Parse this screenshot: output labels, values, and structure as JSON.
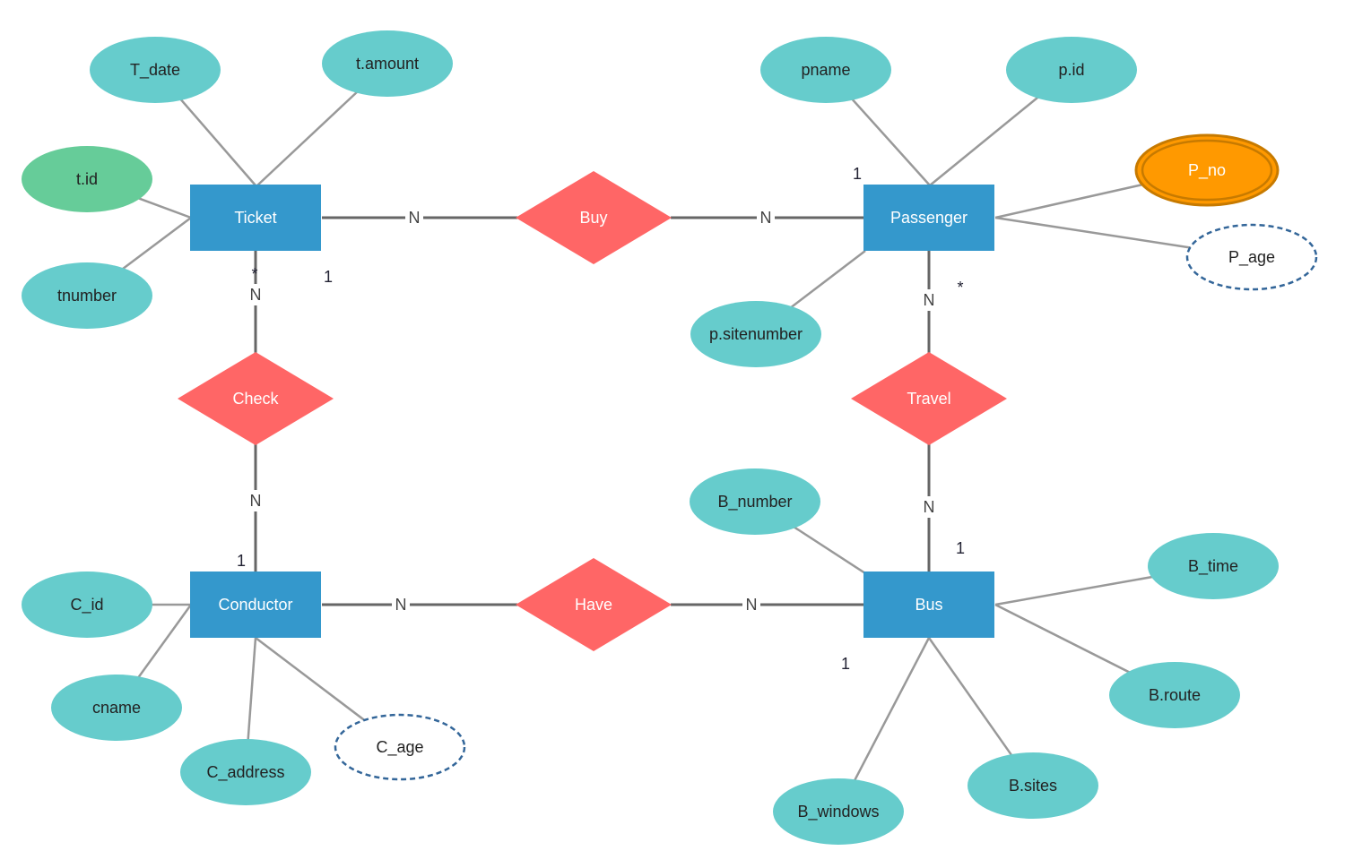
{
  "colors": {
    "entity": "#3498cc",
    "relationship": "#ff6666",
    "attribute": "#66cccc",
    "key_attribute": "#66cc99",
    "multivalued_fill": "#ff9900",
    "multivalued_stroke": "#c77a00",
    "derived_stroke": "#336699",
    "attr_line": "#999999",
    "rel_line": "#666666"
  },
  "entities": [
    {
      "id": "ticket",
      "label": "Ticket"
    },
    {
      "id": "passenger",
      "label": "Passenger"
    },
    {
      "id": "conductor",
      "label": "Conductor"
    },
    {
      "id": "bus",
      "label": "Bus"
    }
  ],
  "relationships": [
    {
      "id": "buy",
      "label": "Buy"
    },
    {
      "id": "check",
      "label": "Check"
    },
    {
      "id": "travel",
      "label": "Travel"
    },
    {
      "id": "have",
      "label": "Have"
    }
  ],
  "attributes": [
    {
      "id": "t_date",
      "label": "T_date",
      "entity": "ticket",
      "kind": "normal"
    },
    {
      "id": "t_amount",
      "label": "t.amount",
      "entity": "ticket",
      "kind": "normal"
    },
    {
      "id": "t_id",
      "label": "t.id",
      "entity": "ticket",
      "kind": "key"
    },
    {
      "id": "tnumber",
      "label": "tnumber",
      "entity": "ticket",
      "kind": "normal"
    },
    {
      "id": "pname",
      "label": "pname",
      "entity": "passenger",
      "kind": "normal"
    },
    {
      "id": "p_id",
      "label": "p.id",
      "entity": "passenger",
      "kind": "normal"
    },
    {
      "id": "p_no",
      "label": "P_no",
      "entity": "passenger",
      "kind": "multivalued"
    },
    {
      "id": "p_age",
      "label": "P_age",
      "entity": "passenger",
      "kind": "derived"
    },
    {
      "id": "p_sitenumber",
      "label": "p.sitenumber",
      "entity": "passenger",
      "kind": "normal"
    },
    {
      "id": "b_number",
      "label": "B_number",
      "entity": "bus",
      "kind": "normal"
    },
    {
      "id": "b_time",
      "label": "B_time",
      "entity": "bus",
      "kind": "normal"
    },
    {
      "id": "b_route",
      "label": "B.route",
      "entity": "bus",
      "kind": "normal"
    },
    {
      "id": "b_sites",
      "label": "B.sites",
      "entity": "bus",
      "kind": "normal"
    },
    {
      "id": "b_windows",
      "label": "B_windows",
      "entity": "bus",
      "kind": "normal"
    },
    {
      "id": "c_id",
      "label": "C_id",
      "entity": "conductor",
      "kind": "normal"
    },
    {
      "id": "cname",
      "label": "cname",
      "entity": "conductor",
      "kind": "normal"
    },
    {
      "id": "c_address",
      "label": "C_address",
      "entity": "conductor",
      "kind": "normal"
    },
    {
      "id": "c_age",
      "label": "C_age",
      "entity": "conductor",
      "kind": "derived"
    }
  ],
  "links": [
    {
      "id": "ticket_buy",
      "from": "ticket",
      "to": "buy",
      "label": "N"
    },
    {
      "id": "buy_passenger",
      "from": "buy",
      "to": "passenger",
      "label": "N"
    },
    {
      "id": "ticket_check",
      "from": "ticket",
      "to": "check",
      "label": "N"
    },
    {
      "id": "check_conductor",
      "from": "check",
      "to": "conductor",
      "label": "N"
    },
    {
      "id": "passenger_travel",
      "from": "passenger",
      "to": "travel",
      "label": "N"
    },
    {
      "id": "travel_bus",
      "from": "travel",
      "to": "bus",
      "label": "N"
    },
    {
      "id": "conductor_have",
      "from": "conductor",
      "to": "have",
      "label": "N"
    },
    {
      "id": "have_bus",
      "from": "have",
      "to": "bus",
      "label": "N"
    }
  ],
  "annotations": [
    {
      "id": "ticket_star",
      "text": "*"
    },
    {
      "id": "ticket_one",
      "text": "1"
    },
    {
      "id": "passenger_one",
      "text": "1"
    },
    {
      "id": "passenger_star",
      "text": "*"
    },
    {
      "id": "conductor_one",
      "text": "1"
    },
    {
      "id": "bus_one_top",
      "text": "1"
    },
    {
      "id": "bus_one_left",
      "text": "1"
    }
  ]
}
